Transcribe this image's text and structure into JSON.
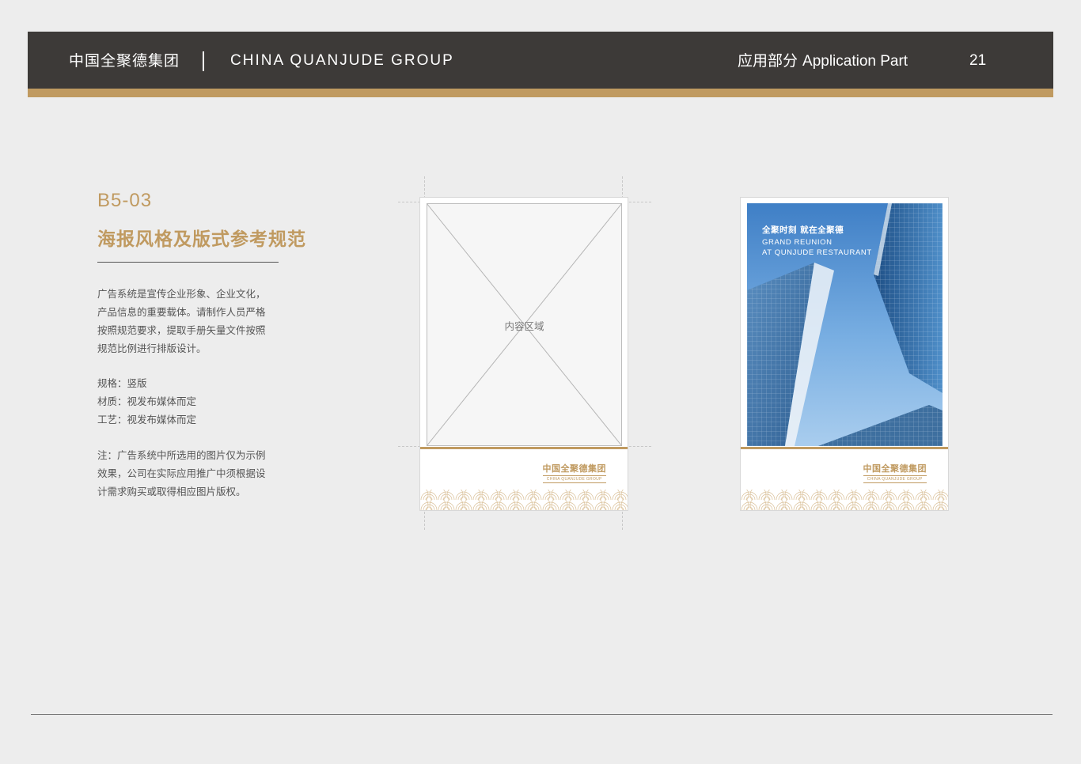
{
  "header": {
    "brand_cn": "中国全聚德集团",
    "brand_en": "CHINA QUANJUDE GROUP",
    "section_cn": "应用部分",
    "section_en": "Application Part",
    "page_number": "21"
  },
  "colors": {
    "header_bg": "#3d3a38",
    "accent_gold": "#c09a60",
    "page_bg": "#ededed"
  },
  "content": {
    "code": "B5-03",
    "title": "海报风格及版式参考规范",
    "description_lines": [
      "广告系统是宣传企业形象、企业文化，",
      "产品信息的重要载体。请制作人员严格",
      "按照规范要求，提取手册矢量文件按照",
      "规范比例进行排版设计。"
    ],
    "specs": [
      "规格：竖版",
      "材质：视发布媒体而定",
      "工艺：视发布媒体而定"
    ],
    "note_lines": [
      "注：广告系统中所选用的图片仅为示例",
      "效果，公司在实际应用推广中须根据设",
      "计需求购买或取得相应图片版权。"
    ]
  },
  "posters": {
    "template": {
      "placeholder_label": "内容区域",
      "logo_cn": "中国全聚德集团",
      "logo_en": "CHINA QUANJUDE GROUP"
    },
    "example": {
      "headline_cn": "全聚时刻 就在全聚德",
      "headline_en_1": "GRAND REUNION",
      "headline_en_2": "AT QUNJUDE RESTAURANT",
      "logo_cn": "中国全聚德集团",
      "logo_en": "CHINA QUANJUDE GROUP"
    }
  }
}
